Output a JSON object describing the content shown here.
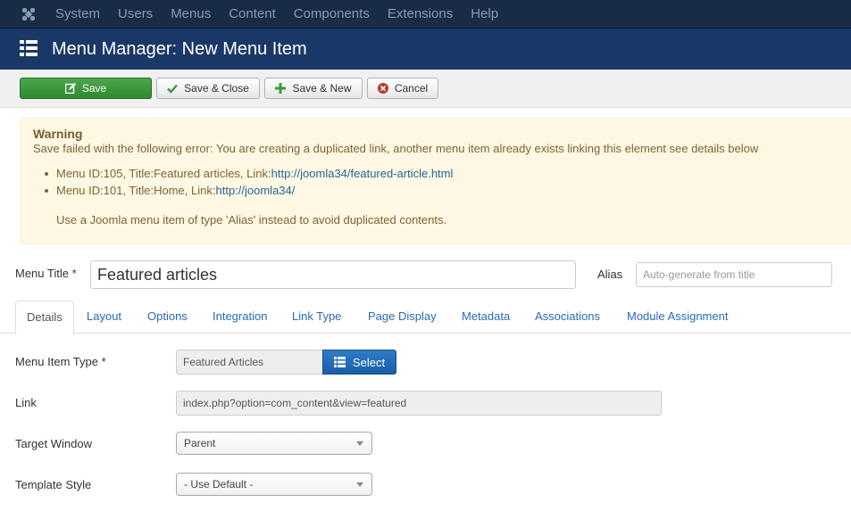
{
  "topnav": {
    "items": [
      "System",
      "Users",
      "Menus",
      "Content",
      "Components",
      "Extensions",
      "Help"
    ]
  },
  "header": {
    "title": "Menu Manager: New Menu Item"
  },
  "toolbar": {
    "save": "Save",
    "save_close": "Save & Close",
    "save_new": "Save & New",
    "cancel": "Cancel"
  },
  "warning": {
    "title": "Warning",
    "message": "Save failed with the following error: You are creating a duplicated link, another menu item already exists linking this element see details below",
    "items": [
      {
        "text": "Menu ID:105, Title:Featured articles, Link:",
        "link": "http://joomla34/featured-article.html"
      },
      {
        "text": "Menu ID:101, Title:Home, Link:",
        "link": "http://joomla34/"
      }
    ],
    "hint": "Use a Joomla menu item of type 'Alias' instead to avoid duplicated contents."
  },
  "form": {
    "menu_title_label": "Menu Title *",
    "menu_title_value": "Featured articles",
    "alias_label": "Alias",
    "alias_placeholder": "Auto-generate from title",
    "menu_item_type_label": "Menu Item Type *",
    "menu_item_type_value": "Featured Articles",
    "select_button": "Select",
    "link_label": "Link",
    "link_value": "index.php?option=com_content&view=featured",
    "target_window_label": "Target Window",
    "target_window_value": "Parent",
    "template_style_label": "Template Style",
    "template_style_value": "- Use Default -"
  },
  "tabs": [
    "Details",
    "Layout",
    "Options",
    "Integration",
    "Link Type",
    "Page Display",
    "Metadata",
    "Associations",
    "Module Assignment"
  ],
  "colors": {
    "topnav_bg": "#182c46",
    "titlebar_bg": "#1a3867",
    "save_green": "#2f8a2f",
    "primary_blue": "#1a5da9",
    "warning_bg": "#fcf8e3",
    "link_blue": "#2a69b8"
  },
  "icons": {
    "logo": "joomla-logo",
    "title": "list-icon",
    "save": "edit-icon",
    "save_close": "check-icon",
    "save_new": "plus-icon",
    "cancel": "cancel-circle-icon",
    "select": "list-icon",
    "dropdown": "caret-down-icon"
  }
}
